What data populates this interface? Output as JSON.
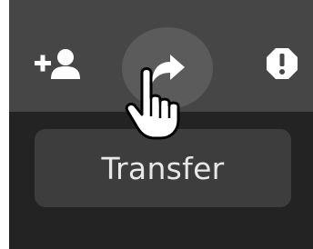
{
  "toolbar": {
    "buttons": [
      {
        "name": "add-user",
        "icon": "add-user-icon"
      },
      {
        "name": "transfer",
        "icon": "arrow-right-icon",
        "hovered": true
      },
      {
        "name": "report",
        "icon": "alert-octagon-icon"
      }
    ]
  },
  "tooltip": {
    "text": "Transfer"
  },
  "colors": {
    "toolbar_bg": "#464646",
    "panel_bg": "#232323",
    "tooltip_bg": "#3d3d3d",
    "hover_circle": "#5b5b5b",
    "icon": "#ffffff",
    "text": "#e8e8e8"
  },
  "cursor": {
    "type": "hand-pointer-icon"
  }
}
